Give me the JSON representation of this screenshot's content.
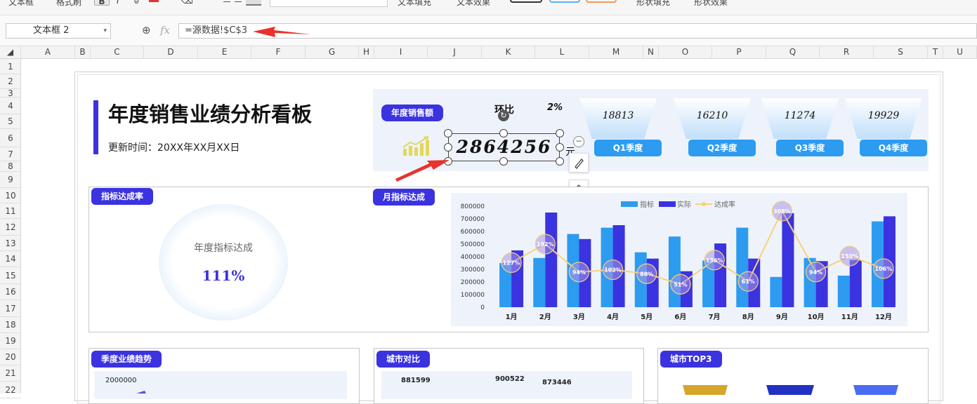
{
  "toolbar": {
    "text_box": "文本框",
    "format_painter": "格式刷",
    "bold": "B",
    "italic": "I",
    "text_fill": "文本填充",
    "text_effect": "文本效果",
    "shape_fill": "形状填充",
    "shape_effect": "形状效果"
  },
  "formula_bar": {
    "name_box": "文本框 2",
    "fx": "fx",
    "formula": "=源数据!$C$3"
  },
  "columns": [
    "A",
    "B",
    "C",
    "D",
    "E",
    "F",
    "G",
    "H",
    "I",
    "J",
    "K",
    "L",
    "M",
    "N",
    "O",
    "P",
    "Q",
    "R",
    "S",
    "T",
    "U"
  ],
  "rows": [
    "1",
    "2",
    "3",
    "4",
    "5",
    "6",
    "7",
    "8",
    "9",
    "10",
    "11",
    "12",
    "13",
    "14",
    "15",
    "16",
    "17",
    "18",
    "19",
    "20",
    "21",
    "22"
  ],
  "dashboard": {
    "title": "年度销售业绩分析看板",
    "update_time": "更新时间：20XX年XX月XX日",
    "annual_sales_label": "年度销售额",
    "yoy_label": "环比",
    "yoy_value": "2%",
    "annual_sales_value": "2864256",
    "unit": "元",
    "quarters": [
      {
        "label": "Q1季度",
        "value": "18813"
      },
      {
        "label": "Q2季度",
        "value": "16210"
      },
      {
        "label": "Q3季度",
        "value": "11274"
      },
      {
        "label": "Q4季度",
        "value": "19929"
      }
    ],
    "target_rate_label": "指标达成率",
    "gauge_title": "年度指标达成",
    "gauge_value": "111%",
    "monthly_label": "月指标达成",
    "quarterly_trend_label": "季度业绩趋势",
    "trend_axis_top": "2000000",
    "city_compare_label": "城市对比",
    "city_values": [
      "881599",
      "900522",
      "873446"
    ],
    "city_top3_label": "城市TOP3"
  },
  "colors": {
    "accent": "#3b32e0",
    "target": "#2d9bf0",
    "actual": "#3b32e0",
    "rate_line": "#f8d17a",
    "arrow": "#e8322c"
  },
  "chart_data": {
    "type": "bar",
    "categories": [
      "1月",
      "2月",
      "3月",
      "4月",
      "5月",
      "6月",
      "7月",
      "8月",
      "9月",
      "10月",
      "11月",
      "12月"
    ],
    "series": [
      {
        "name": "指标",
        "values": [
          350000,
          390000,
          580000,
          630000,
          435000,
          560000,
          370000,
          630000,
          240000,
          390000,
          250000,
          680000
        ]
      },
      {
        "name": "实际",
        "values": [
          450000,
          750000,
          540000,
          650000,
          385000,
          285000,
          505000,
          385000,
          745000,
          365000,
          375000,
          720000
        ]
      },
      {
        "name": "达成率",
        "type": "line",
        "values": [
          127,
          192,
          94,
          102,
          88,
          51,
          136,
          61,
          308,
          94,
          150,
          106
        ]
      }
    ],
    "rate_labels": [
      "127%",
      "192%",
      "94%",
      "102%",
      "88%",
      "51%",
      "136%",
      "61%",
      "308%",
      "94%",
      "150%",
      "106%"
    ],
    "y_ticks": [
      "0",
      "100000",
      "200000",
      "300000",
      "400000",
      "500000",
      "600000",
      "700000",
      "800000"
    ],
    "ylim": [
      0,
      800000
    ]
  }
}
